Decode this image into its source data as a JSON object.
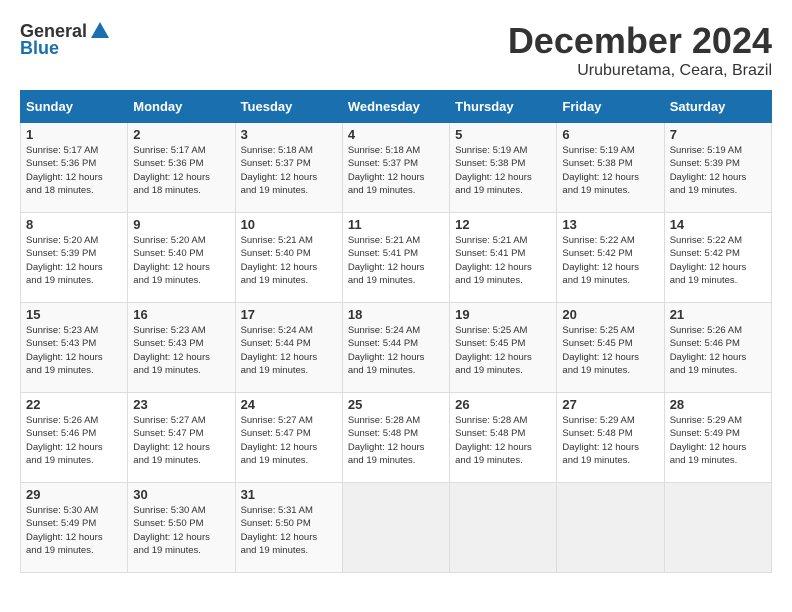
{
  "logo": {
    "general": "General",
    "blue": "Blue"
  },
  "title": "December 2024",
  "location": "Uruburetama, Ceara, Brazil",
  "days_of_week": [
    "Sunday",
    "Monday",
    "Tuesday",
    "Wednesday",
    "Thursday",
    "Friday",
    "Saturday"
  ],
  "weeks": [
    [
      {
        "day": "1",
        "sunrise": "5:17 AM",
        "sunset": "5:36 PM",
        "daylight": "12 hours and 18 minutes."
      },
      {
        "day": "2",
        "sunrise": "5:17 AM",
        "sunset": "5:36 PM",
        "daylight": "12 hours and 18 minutes."
      },
      {
        "day": "3",
        "sunrise": "5:18 AM",
        "sunset": "5:37 PM",
        "daylight": "12 hours and 19 minutes."
      },
      {
        "day": "4",
        "sunrise": "5:18 AM",
        "sunset": "5:37 PM",
        "daylight": "12 hours and 19 minutes."
      },
      {
        "day": "5",
        "sunrise": "5:19 AM",
        "sunset": "5:38 PM",
        "daylight": "12 hours and 19 minutes."
      },
      {
        "day": "6",
        "sunrise": "5:19 AM",
        "sunset": "5:38 PM",
        "daylight": "12 hours and 19 minutes."
      },
      {
        "day": "7",
        "sunrise": "5:19 AM",
        "sunset": "5:39 PM",
        "daylight": "12 hours and 19 minutes."
      }
    ],
    [
      {
        "day": "8",
        "sunrise": "5:20 AM",
        "sunset": "5:39 PM",
        "daylight": "12 hours and 19 minutes."
      },
      {
        "day": "9",
        "sunrise": "5:20 AM",
        "sunset": "5:40 PM",
        "daylight": "12 hours and 19 minutes."
      },
      {
        "day": "10",
        "sunrise": "5:21 AM",
        "sunset": "5:40 PM",
        "daylight": "12 hours and 19 minutes."
      },
      {
        "day": "11",
        "sunrise": "5:21 AM",
        "sunset": "5:41 PM",
        "daylight": "12 hours and 19 minutes."
      },
      {
        "day": "12",
        "sunrise": "5:21 AM",
        "sunset": "5:41 PM",
        "daylight": "12 hours and 19 minutes."
      },
      {
        "day": "13",
        "sunrise": "5:22 AM",
        "sunset": "5:42 PM",
        "daylight": "12 hours and 19 minutes."
      },
      {
        "day": "14",
        "sunrise": "5:22 AM",
        "sunset": "5:42 PM",
        "daylight": "12 hours and 19 minutes."
      }
    ],
    [
      {
        "day": "15",
        "sunrise": "5:23 AM",
        "sunset": "5:43 PM",
        "daylight": "12 hours and 19 minutes."
      },
      {
        "day": "16",
        "sunrise": "5:23 AM",
        "sunset": "5:43 PM",
        "daylight": "12 hours and 19 minutes."
      },
      {
        "day": "17",
        "sunrise": "5:24 AM",
        "sunset": "5:44 PM",
        "daylight": "12 hours and 19 minutes."
      },
      {
        "day": "18",
        "sunrise": "5:24 AM",
        "sunset": "5:44 PM",
        "daylight": "12 hours and 19 minutes."
      },
      {
        "day": "19",
        "sunrise": "5:25 AM",
        "sunset": "5:45 PM",
        "daylight": "12 hours and 19 minutes."
      },
      {
        "day": "20",
        "sunrise": "5:25 AM",
        "sunset": "5:45 PM",
        "daylight": "12 hours and 19 minutes."
      },
      {
        "day": "21",
        "sunrise": "5:26 AM",
        "sunset": "5:46 PM",
        "daylight": "12 hours and 19 minutes."
      }
    ],
    [
      {
        "day": "22",
        "sunrise": "5:26 AM",
        "sunset": "5:46 PM",
        "daylight": "12 hours and 19 minutes."
      },
      {
        "day": "23",
        "sunrise": "5:27 AM",
        "sunset": "5:47 PM",
        "daylight": "12 hours and 19 minutes."
      },
      {
        "day": "24",
        "sunrise": "5:27 AM",
        "sunset": "5:47 PM",
        "daylight": "12 hours and 19 minutes."
      },
      {
        "day": "25",
        "sunrise": "5:28 AM",
        "sunset": "5:48 PM",
        "daylight": "12 hours and 19 minutes."
      },
      {
        "day": "26",
        "sunrise": "5:28 AM",
        "sunset": "5:48 PM",
        "daylight": "12 hours and 19 minutes."
      },
      {
        "day": "27",
        "sunrise": "5:29 AM",
        "sunset": "5:48 PM",
        "daylight": "12 hours and 19 minutes."
      },
      {
        "day": "28",
        "sunrise": "5:29 AM",
        "sunset": "5:49 PM",
        "daylight": "12 hours and 19 minutes."
      }
    ],
    [
      {
        "day": "29",
        "sunrise": "5:30 AM",
        "sunset": "5:49 PM",
        "daylight": "12 hours and 19 minutes."
      },
      {
        "day": "30",
        "sunrise": "5:30 AM",
        "sunset": "5:50 PM",
        "daylight": "12 hours and 19 minutes."
      },
      {
        "day": "31",
        "sunrise": "5:31 AM",
        "sunset": "5:50 PM",
        "daylight": "12 hours and 19 minutes."
      },
      null,
      null,
      null,
      null
    ]
  ],
  "labels": {
    "sunrise": "Sunrise:",
    "sunset": "Sunset:",
    "daylight": "Daylight:"
  }
}
